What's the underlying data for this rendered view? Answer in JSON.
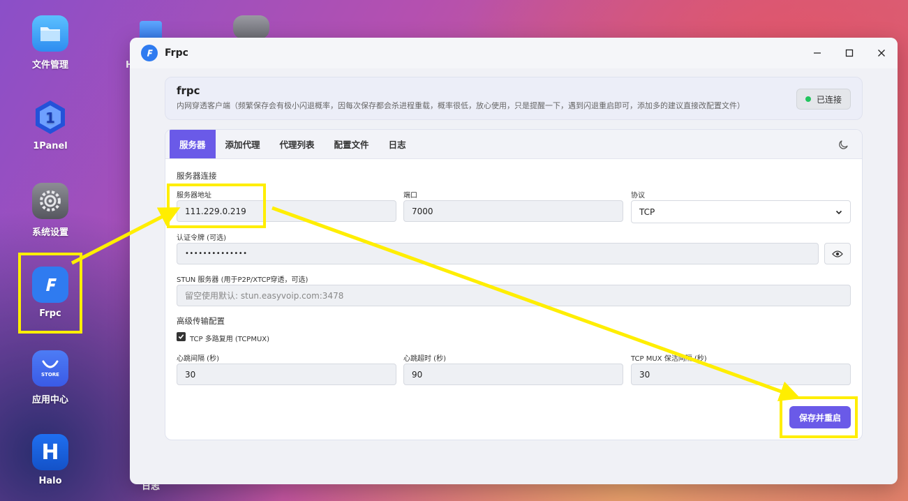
{
  "desktop": {
    "icons": [
      {
        "label": "文件管理",
        "icon": "folder-icon"
      },
      {
        "label": "1Panel",
        "icon": "1panel-logo-icon"
      },
      {
        "label": "系统设置",
        "icon": "gear-icon"
      },
      {
        "label": "Frpc",
        "icon": "frpc-logo-icon"
      },
      {
        "label": "应用中心",
        "icon": "store-icon",
        "badge": "STORE"
      },
      {
        "label": "Halo",
        "icon": "halo-logo-icon",
        "glyph": "H"
      }
    ],
    "partial_label_1": "H",
    "partial_label_2": "日志"
  },
  "window": {
    "title": "Frpc",
    "header": {
      "title": "frpc",
      "description": "内网穿透客户端（频繁保存会有极小闪退概率，因每次保存都会杀进程重载，概率很低，放心使用，只是提醒一下，遇到闪退重启即可，添加多的建议直接改配置文件）",
      "status": "已连接",
      "status_color": "#22c55e"
    },
    "tabs": [
      {
        "label": "服务器",
        "active": true
      },
      {
        "label": "添加代理",
        "active": false
      },
      {
        "label": "代理列表",
        "active": false
      },
      {
        "label": "配置文件",
        "active": false
      },
      {
        "label": "日志",
        "active": false
      }
    ],
    "form": {
      "section_connection": "服务器连接",
      "server_addr_label": "服务器地址",
      "server_addr_value": "111.229.0.219",
      "port_label": "端口",
      "port_value": "7000",
      "protocol_label": "协议",
      "protocol_value": "TCP",
      "token_label": "认证令牌 (可选)",
      "token_value": "••••••••••••••",
      "stun_label": "STUN 服务器 (用于P2P/XTCP穿透，可选)",
      "stun_placeholder": "留空使用默认: stun.easyvoip.com:3478",
      "section_advanced": "高级传输配置",
      "tcpmux_label": "TCP 多路复用 (TCPMUX)",
      "tcpmux_checked": true,
      "heartbeat_interval_label": "心跳间隔 (秒)",
      "heartbeat_interval_value": "30",
      "heartbeat_timeout_label": "心跳超时 (秒)",
      "heartbeat_timeout_value": "90",
      "tcpmux_keepalive_label": "TCP MUX 保活间隔 (秒)",
      "tcpmux_keepalive_value": "30",
      "save_label": "保存并重启"
    },
    "accent_color": "#6a5ae8"
  },
  "annotation_color": "#ffee00"
}
